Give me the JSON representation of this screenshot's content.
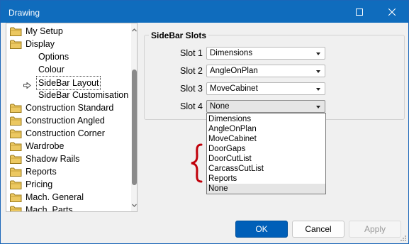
{
  "window": {
    "title": "Drawing"
  },
  "tree": {
    "items": [
      {
        "label": "My Setup",
        "type": "folder"
      },
      {
        "label": "Display",
        "type": "folder"
      },
      {
        "label": "Options",
        "type": "child"
      },
      {
        "label": "Colour",
        "type": "child"
      },
      {
        "label": "SideBar Layout",
        "type": "child",
        "selected": true
      },
      {
        "label": "SideBar Customisation",
        "type": "child"
      },
      {
        "label": "Construction Standard",
        "type": "folder"
      },
      {
        "label": "Construction Angled",
        "type": "folder"
      },
      {
        "label": "Construction Corner",
        "type": "folder"
      },
      {
        "label": "Wardrobe",
        "type": "folder"
      },
      {
        "label": "Shadow Rails",
        "type": "folder"
      },
      {
        "label": "Reports",
        "type": "folder"
      },
      {
        "label": "Pricing",
        "type": "folder"
      },
      {
        "label": "Mach. General",
        "type": "folder"
      },
      {
        "label": "Mach. Parts",
        "type": "folder"
      }
    ]
  },
  "sidebar_slots": {
    "title": "SideBar Slots",
    "slots": [
      {
        "label": "Slot 1",
        "value": "Dimensions"
      },
      {
        "label": "Slot 2",
        "value": "AngleOnPlan"
      },
      {
        "label": "Slot 3",
        "value": "MoveCabinet"
      },
      {
        "label": "Slot 4",
        "value": "None"
      }
    ],
    "dropdown_options": [
      "Dimensions",
      "AngleOnPlan",
      "MoveCabinet",
      "DoorGaps",
      "DoorCutList",
      "CarcassCutList",
      "Reports",
      "None"
    ],
    "dropdown_selected": "None"
  },
  "buttons": {
    "ok": "OK",
    "cancel": "Cancel",
    "apply": "Apply"
  },
  "colors": {
    "titlebar": "#0f6cbd",
    "ok_button": "#005fb8",
    "annotation_brace": "#c0000a",
    "folder": "#e8c04a"
  },
  "icons": {
    "maximize": "maximize-icon",
    "close": "close-icon",
    "folder": "folder-icon",
    "selected_arrow": "arrow-right-icon",
    "dropdown_caret": "chevron-down-icon",
    "brace": "curly-brace-annotation"
  }
}
